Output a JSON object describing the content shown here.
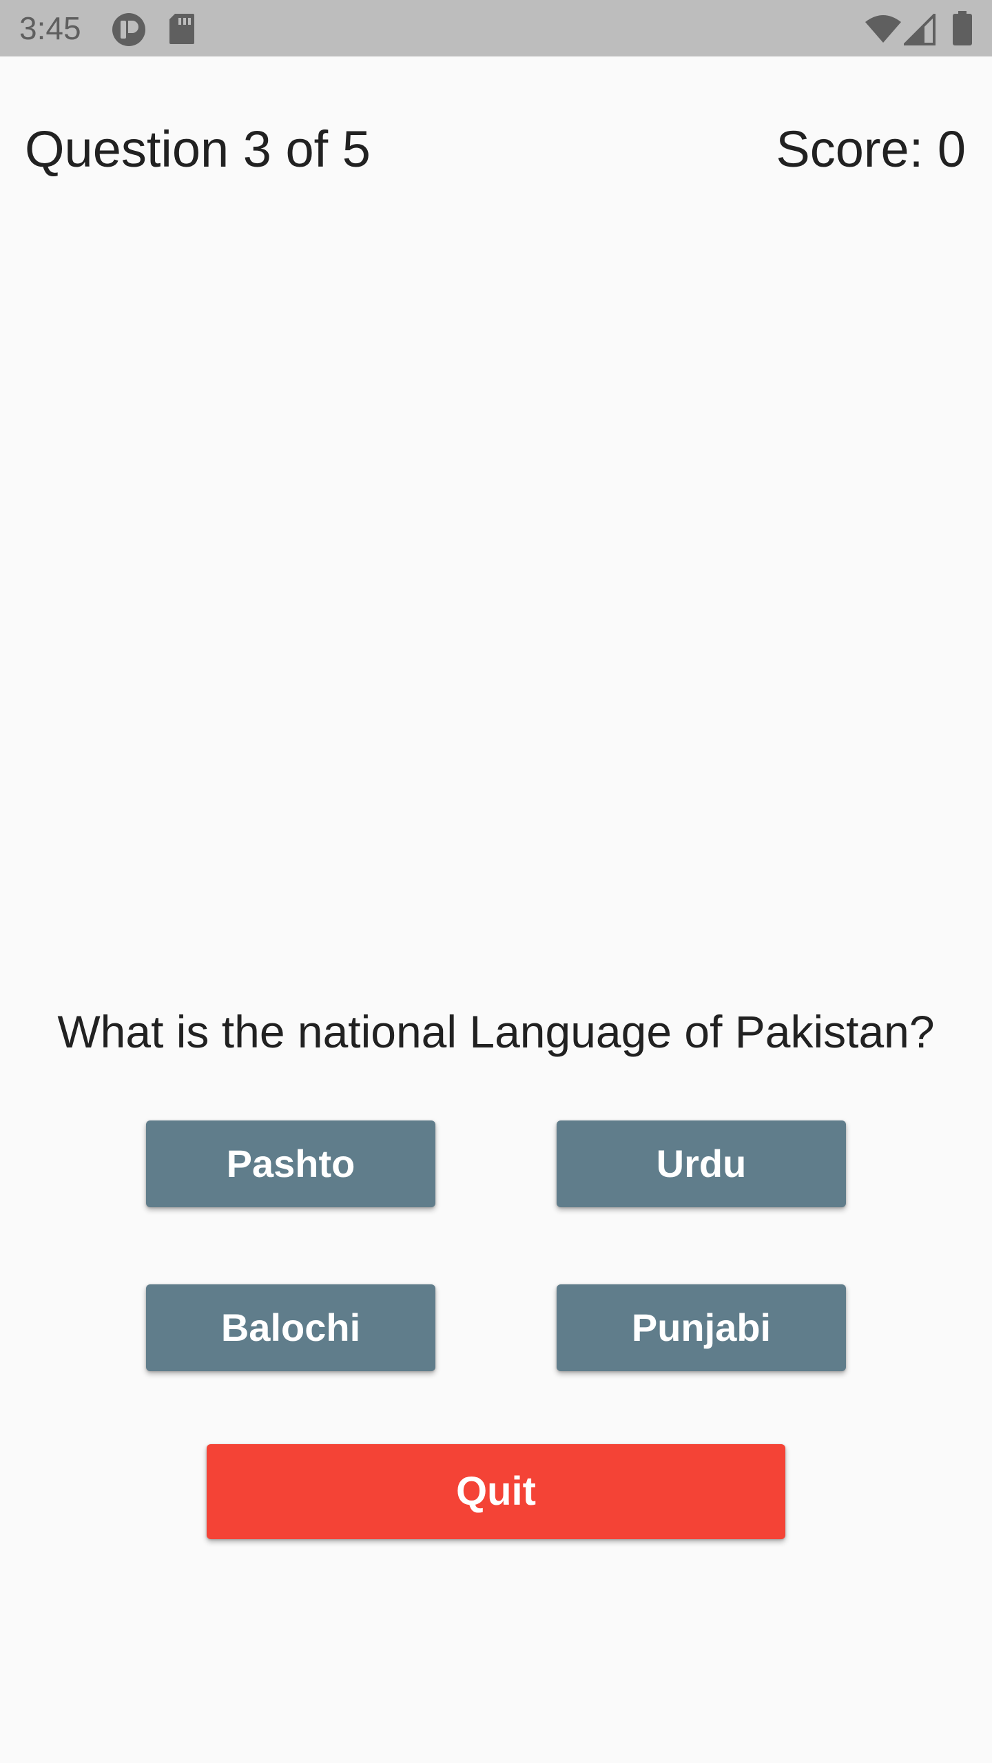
{
  "status_bar": {
    "time": "3:45",
    "icons": [
      "app-notification-icon",
      "sd-card-icon",
      "wifi-icon",
      "signal-icon",
      "battery-icon"
    ]
  },
  "header": {
    "question_counter": "Question 3 of 5",
    "score": "Score: 0"
  },
  "question": {
    "text": "What is the national Language of Pakistan?"
  },
  "answers": [
    "Pashto",
    "Urdu",
    "Balochi",
    "Punjabi"
  ],
  "quit_label": "Quit",
  "colors": {
    "status_bar": "#bdbdbd",
    "background": "#fafafa",
    "answer_button": "#607d8b",
    "quit_button": "#f44336",
    "text": "#212121"
  }
}
